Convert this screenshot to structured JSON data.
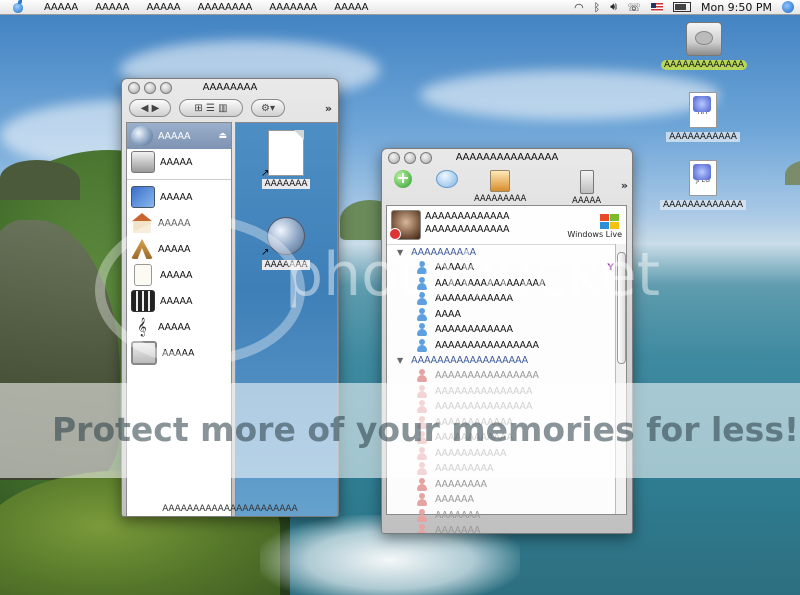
{
  "menubar": {
    "menus": [
      "ААААА",
      "ААААА",
      "ААААА",
      "АААААААА",
      "ААААААА",
      "ААААА"
    ],
    "clock": "Mon 9:50 PM"
  },
  "desktop_icons": [
    {
      "label": "ААААААААААААА",
      "kind": "hard-drive"
    },
    {
      "label": "ААААААААААА",
      "kind": "tiff-file",
      "badge": "TIFF"
    },
    {
      "label": "ААААААААААААА",
      "kind": "jpeg-file",
      "badge": "JPEG"
    }
  ],
  "finder": {
    "title": "АААААААА",
    "sidebar": [
      {
        "label": "ААААА",
        "icon": "network-disk-icon",
        "selected": true
      },
      {
        "label": "ААААА",
        "icon": "hard-drive-icon",
        "selected": false
      },
      {
        "label": "ААААА",
        "icon": "desktop-icon",
        "selected": false
      },
      {
        "label": "ААААА",
        "icon": "home-icon",
        "selected": false
      },
      {
        "label": "ААААА",
        "icon": "applications-icon",
        "selected": false
      },
      {
        "label": "ААААА",
        "icon": "documents-icon",
        "selected": false
      },
      {
        "label": "ААААА",
        "icon": "movies-icon",
        "selected": false
      },
      {
        "label": "ААААА",
        "icon": "music-icon",
        "selected": false
      },
      {
        "label": "ААААА",
        "icon": "pictures-icon",
        "selected": false
      }
    ],
    "items": [
      {
        "label": "ААААААА",
        "kind": "document-alias"
      },
      {
        "label": "ААААААА",
        "kind": "globe-alias"
      }
    ],
    "status": "АААААААААААААААААААААА"
  },
  "messenger": {
    "title": "ААААААААААААААА",
    "toolbar": [
      "",
      "",
      "ААААААААА",
      "ААААА"
    ],
    "profile": {
      "name": "ААААААААААААА",
      "message": "ААААААААААААА"
    },
    "brand": "Windows Live",
    "groups": [
      {
        "name": "АААААААААА",
        "contacts": [
          {
            "name": "АААААА",
            "status": "online",
            "yahoo": true
          },
          {
            "name": "ААААААААААААААААА",
            "status": "online",
            "yahoo": false
          },
          {
            "name": "АААААААААААА",
            "status": "online",
            "yahoo": false
          },
          {
            "name": "АААА",
            "status": "online",
            "yahoo": false
          },
          {
            "name": "АААААААААААА",
            "status": "online",
            "yahoo": false
          },
          {
            "name": "АААААААААААААААА",
            "status": "online",
            "yahoo": false
          }
        ]
      },
      {
        "name": "АААААААААААААААААА",
        "contacts": [
          {
            "name": "АААААААААААААААА",
            "status": "offline",
            "yahoo": false
          },
          {
            "name": "ААААААААААААААА",
            "status": "offline",
            "yahoo": false
          },
          {
            "name": "ААААААААААААААА",
            "status": "offline",
            "yahoo": false
          },
          {
            "name": "АААААААААААА",
            "status": "offline",
            "yahoo": false
          },
          {
            "name": "АААААААААААА",
            "status": "offline",
            "yahoo": false
          },
          {
            "name": "ААААААААААА",
            "status": "offline",
            "yahoo": false
          },
          {
            "name": "ААААААААА",
            "status": "offline",
            "yahoo": false
          },
          {
            "name": "АААААААА",
            "status": "offline",
            "yahoo": false
          },
          {
            "name": "АААААА",
            "status": "offline",
            "yahoo": false
          },
          {
            "name": "ААААААА",
            "status": "offline",
            "yahoo": false
          },
          {
            "name": "ААААААА",
            "status": "offline",
            "yahoo": false
          }
        ]
      }
    ]
  },
  "watermark": {
    "brand": "photobucket",
    "text": "Protect more of your memories for less!"
  }
}
